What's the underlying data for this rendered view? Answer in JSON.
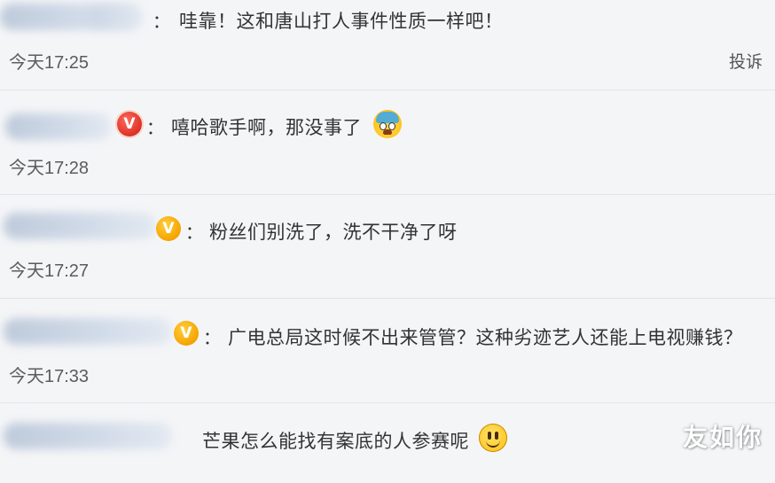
{
  "comments": [
    {
      "text": "哇靠！这和唐山打人事件性质一样吧！",
      "time": "今天17:25",
      "report_label": "投诉",
      "badge": "none"
    },
    {
      "text": "嘻哈歌手啊，那没事了",
      "time": "今天17:28",
      "badge": "red-vip",
      "badge_letter": "V",
      "emoji": "scared-face-icon"
    },
    {
      "text": "粉丝们别洗了，洗不干净了呀",
      "time": "今天17:27",
      "badge": "gold-vip",
      "badge_letter": "V"
    },
    {
      "text": "广电总局这时候不出来管管？这种劣迹艺人还能上电视赚钱？",
      "time": "今天17:33",
      "badge": "gold-vip",
      "badge_letter": "V"
    },
    {
      "text": "芒果怎么能找有案底的人参赛呢",
      "badge": "none",
      "emoji": "smile-face-icon"
    }
  ],
  "separator": "：",
  "watermark": "友如你",
  "colors": {
    "background": "#f4f5f7",
    "divider": "#e3e4e8",
    "text": "#333333",
    "timestamp": "#5c5c5c",
    "vip_red": "#e0352b",
    "vip_gold": "#f5a300"
  }
}
